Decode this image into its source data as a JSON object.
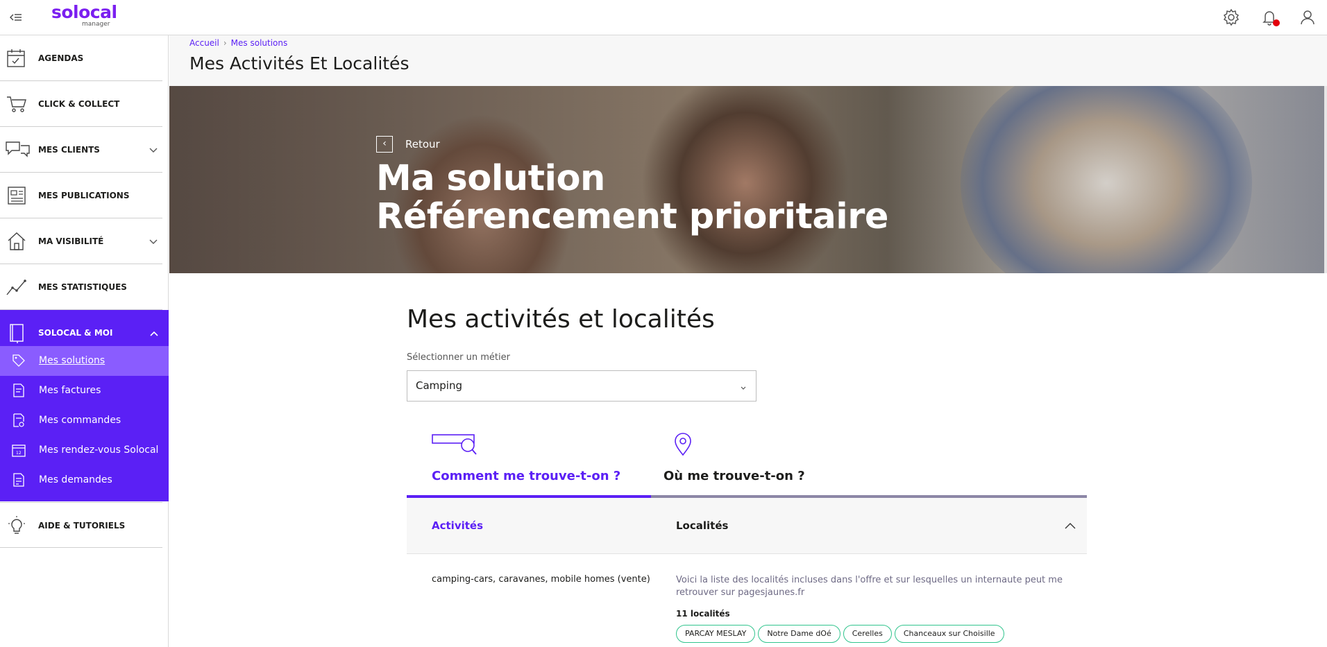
{
  "app": {
    "logo_text": "solocal",
    "logo_sub": "manager"
  },
  "sidebar": {
    "items": [
      {
        "label": "AGENDAS",
        "icon": "calendar-icon"
      },
      {
        "label": "CLICK & COLLECT",
        "icon": "cart-icon"
      },
      {
        "label": "MES CLIENTS",
        "icon": "chat-bubbles-icon",
        "expandable": true
      },
      {
        "label": "MES PUBLICATIONS",
        "icon": "publication-icon"
      },
      {
        "label": "MA VISIBILITÉ",
        "icon": "house-icon",
        "expandable": true
      },
      {
        "label": "MES STATISTIQUES",
        "icon": "chart-line-icon"
      },
      {
        "label": "SOLOCAL & MOI",
        "icon": "book-icon",
        "expanded": true
      },
      {
        "label": "AIDE & TUTORIELS",
        "icon": "lightbulb-icon"
      }
    ],
    "sub_items": [
      {
        "label": "Mes solutions",
        "icon": "tag-icon",
        "selected": true
      },
      {
        "label": "Mes factures",
        "icon": "invoice-icon"
      },
      {
        "label": "Mes commandes",
        "icon": "order-icon"
      },
      {
        "label": "Mes rendez-vous Solocal",
        "icon": "calendar-12-icon"
      },
      {
        "label": "Mes demandes",
        "icon": "request-icon"
      }
    ]
  },
  "breadcrumb": {
    "home": "Accueil",
    "current": "Mes solutions"
  },
  "page": {
    "title": "Mes Activités Et Localités"
  },
  "hero": {
    "back_label": "Retour",
    "title_line1": "Ma solution",
    "title_line2": "Référencement prioritaire"
  },
  "section": {
    "title": "Mes activités et localités",
    "select_label": "Sélectionner un métier",
    "select_value": "Camping"
  },
  "tabs": [
    {
      "label": "Comment me trouve-t-on ?",
      "active": true,
      "icon": "search-bar-icon"
    },
    {
      "label": "Où me trouve-t-on ?",
      "active": false,
      "icon": "location-pin-icon"
    }
  ],
  "table": {
    "col_activities": "Activités",
    "col_localities": "Localités",
    "activity": "camping-cars, caravanes, mobile homes (vente)",
    "localities_description": "Voici la liste des localités incluses dans l'offre et sur lesquelles un internaute peut me retrouver sur pagesjaunes.fr",
    "localities_count": "11 localités",
    "localities": [
      "PARCAY MESLAY",
      "Notre Dame dOé",
      "Cerelles",
      "Chanceaux sur Choisille"
    ]
  },
  "colors": {
    "accent": "#5b20f5",
    "accent_light": "#8a5cff",
    "chip_border": "#31c48d",
    "notification": "#e3000b"
  }
}
